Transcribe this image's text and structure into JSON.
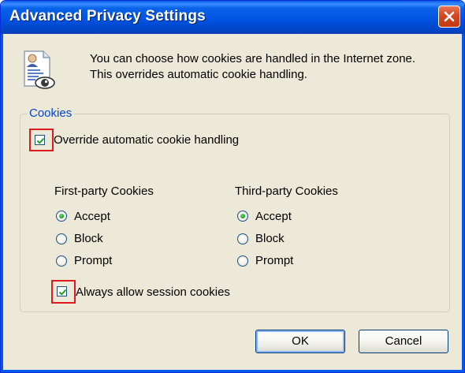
{
  "window": {
    "title": "Advanced Privacy Settings",
    "close_symbol": "close-icon"
  },
  "intro": {
    "icon": "privacy-document-eye-icon",
    "text": "You can choose how cookies are handled in the Internet zone.  This overrides automatic cookie handling."
  },
  "cookies_group": {
    "legend": "Cookies",
    "override": {
      "label": "Override automatic cookie handling",
      "checked": true
    },
    "first_party": {
      "heading": "First-party Cookies",
      "options": [
        "Accept",
        "Block",
        "Prompt"
      ],
      "selected": "Accept"
    },
    "third_party": {
      "heading": "Third-party Cookies",
      "options": [
        "Accept",
        "Block",
        "Prompt"
      ],
      "selected": "Accept"
    },
    "session": {
      "label": "Always allow session cookies",
      "checked": true
    }
  },
  "buttons": {
    "ok": "OK",
    "cancel": "Cancel"
  },
  "colors": {
    "title_bar": "#0054e3",
    "dialog_face": "#ece9d8",
    "legend_text": "#0046d5",
    "highlight_box": "#e0191e",
    "checkmark": "#21a121"
  }
}
